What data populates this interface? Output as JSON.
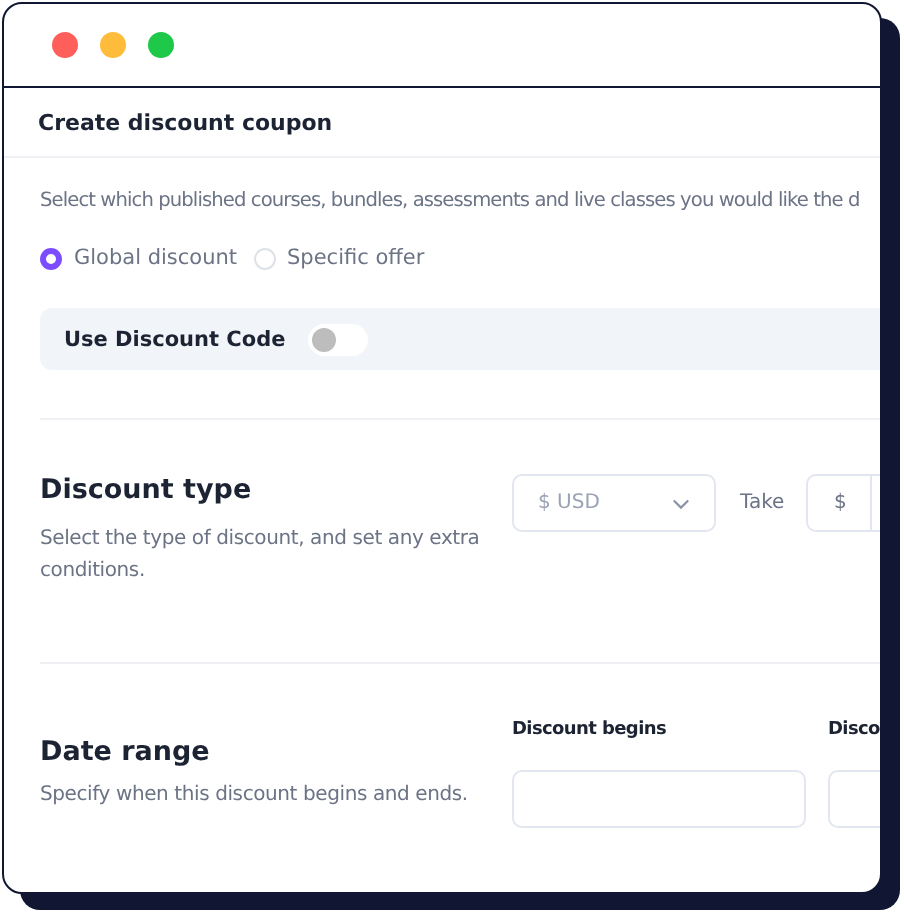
{
  "window": {
    "title": "Create discount coupon"
  },
  "intro": "Select which published courses, bundles, assessments and live classes you would like the d",
  "offer_type": [
    {
      "label": "Global discount",
      "selected": true
    },
    {
      "label": "Specific offer",
      "selected": false
    }
  ],
  "discount_code": {
    "label": "Use Discount Code",
    "on": false
  },
  "sections": [
    {
      "kind": "discount_type",
      "title": "Discount type",
      "description": "Select the type of discount, and set any extra conditions.",
      "currency": "$ USD",
      "take_label": "Take",
      "amount_prefix": "$"
    },
    {
      "kind": "date_range",
      "title": "Date range",
      "description": "Specify when this discount begins and ends.",
      "fields": [
        {
          "label": "Discount begins"
        },
        {
          "label": "Disco"
        }
      ]
    }
  ]
}
